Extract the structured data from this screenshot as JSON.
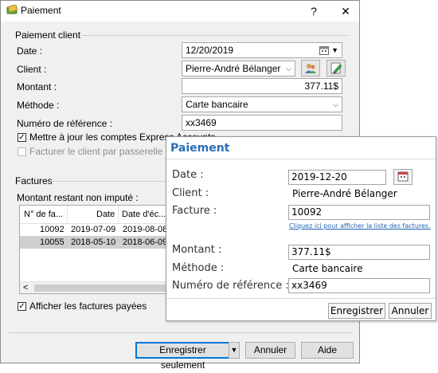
{
  "window": {
    "title": "Paiement",
    "help_symbol": "?",
    "close_symbol": "✕"
  },
  "payment_group": {
    "title": "Paiement client",
    "date_label": "Date :",
    "date_value": "12/20/2019",
    "client_label": "Client :",
    "client_value": "Pierre-André Bélanger",
    "amount_label": "Montant :",
    "amount_value": "377.11$",
    "method_label": "Méthode :",
    "method_value": "Carte bancaire",
    "reference_label": "Numéro de référence :",
    "reference_value": "xx3469",
    "update_express_label": "Mettre à jour les comptes Express Accounts",
    "update_express_checked": true,
    "bill_gateway_label": "Facturer le client par passerelle de carte",
    "bill_gateway_checked": false
  },
  "invoices_group": {
    "title": "Factures",
    "remaining_label": "Montant restant non imputé :",
    "columns": [
      "N° de fa...",
      "Date",
      "Date d'éc..."
    ],
    "rows": [
      {
        "number": "10092",
        "date": "2019-07-09",
        "due": "2019-08-08",
        "selected": false
      },
      {
        "number": "10055",
        "date": "2018-05-10",
        "due": "2018-06-09",
        "selected": true
      }
    ],
    "scroll_left_symbol": "<",
    "show_paid_label": "Afficher les factures payées",
    "show_paid_checked": true
  },
  "footer": {
    "save_only_label": "Enregistrer seulement",
    "cancel_label": "Annuler",
    "help_label": "Aide"
  },
  "popup": {
    "title": "Paiement",
    "title_color": "#2a6fb5",
    "date_label": "Date :",
    "date_value": "2019-12-20",
    "client_label": "Client :",
    "client_value": "Pierre-André Bélanger",
    "invoice_label": "Facture :",
    "invoice_value": "10092",
    "invoice_link": "Cliquez ici pour afficher la liste des factures.",
    "amount_label": "Montant :",
    "amount_value": "377.11$",
    "method_label": "Méthode :",
    "method_value": "Carte bancaire",
    "reference_label": "Numéro de référence :",
    "reference_value": "xx3469",
    "save_label": "Enregistrer",
    "cancel_label": "Annuler"
  }
}
